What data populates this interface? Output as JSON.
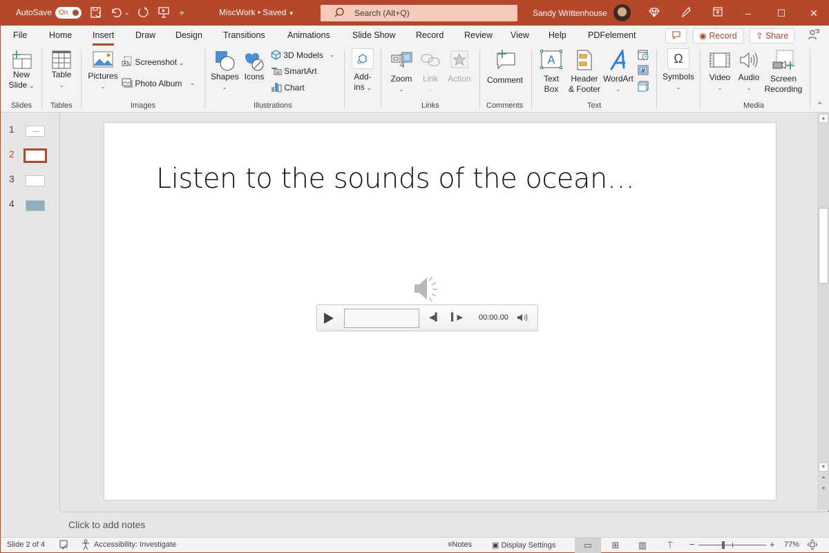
{
  "titlebar": {
    "autosave_label": "AutoSave",
    "autosave_state": "On",
    "doc_title": "MiscWork • Saved",
    "search_placeholder": "Search (Alt+Q)",
    "user_name": "Sandy Writtenhouse"
  },
  "tabs": [
    {
      "label": "File"
    },
    {
      "label": "Home"
    },
    {
      "label": "Insert",
      "active": true
    },
    {
      "label": "Draw"
    },
    {
      "label": "Design"
    },
    {
      "label": "Transitions"
    },
    {
      "label": "Animations"
    },
    {
      "label": "Slide Show"
    },
    {
      "label": "Record"
    },
    {
      "label": "Review"
    },
    {
      "label": "View"
    },
    {
      "label": "Help"
    },
    {
      "label": "PDFelement"
    }
  ],
  "tab_actions": {
    "record_label": "Record",
    "share_label": "Share"
  },
  "ribbon": {
    "groups": {
      "slides": "Slides",
      "tables": "Tables",
      "images": "Images",
      "illustrations": "Illustrations",
      "links": "Links",
      "comments": "Comments",
      "text": "Text",
      "media": "Media"
    },
    "new_slide": [
      "New",
      "Slide"
    ],
    "table": "Table",
    "pictures": "Pictures",
    "screenshot": "Screenshot",
    "photo_album": "Photo Album",
    "shapes": "Shapes",
    "icons": "Icons",
    "models_3d": "3D Models",
    "smartart": "SmartArt",
    "chart": "Chart",
    "addins": [
      "Add-",
      "ins"
    ],
    "zoom": "Zoom",
    "link": "Link",
    "action": "Action",
    "comment": "Comment",
    "text_box": [
      "Text",
      "Box"
    ],
    "header_footer": [
      "Header",
      "& Footer"
    ],
    "wordart": "WordArt",
    "symbols": "Symbols",
    "video": "Video",
    "audio": "Audio",
    "screen_recording": [
      "Screen",
      "Recording"
    ]
  },
  "thumbnails": [
    {
      "num": "1"
    },
    {
      "num": "2",
      "selected": true
    },
    {
      "num": "3"
    },
    {
      "num": "4"
    }
  ],
  "slide": {
    "title": "Listen to the sounds of the ocean…",
    "player_time": "00:00.00"
  },
  "notes": {
    "placeholder": "Click to add notes"
  },
  "status": {
    "slide_info": "Slide 2 of 4",
    "accessibility": "Accessibility: Investigate",
    "notes_label": "Notes",
    "display_settings": "Display Settings",
    "zoom_percent": "77%",
    "zoom_level": 0.77
  }
}
